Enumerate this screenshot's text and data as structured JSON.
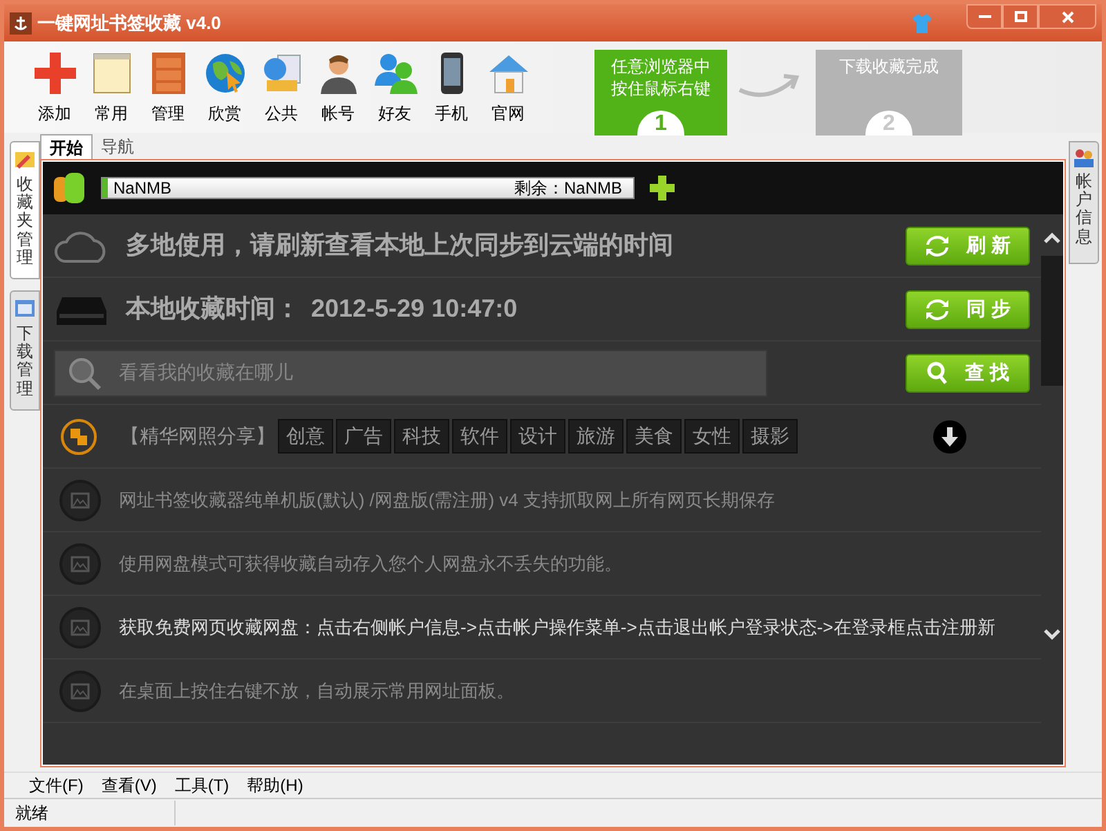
{
  "window": {
    "title": "一键网址书签收藏 v4.0"
  },
  "toolbar": [
    {
      "label": "添加",
      "kind": "plus"
    },
    {
      "label": "常用",
      "kind": "notepad"
    },
    {
      "label": "管理",
      "kind": "cabinet"
    },
    {
      "label": "欣赏",
      "kind": "globe"
    },
    {
      "label": "公共",
      "kind": "share"
    },
    {
      "label": "帐号",
      "kind": "user"
    },
    {
      "label": "好友",
      "kind": "users"
    },
    {
      "label": "手机",
      "kind": "phone"
    },
    {
      "label": "官网",
      "kind": "house"
    }
  ],
  "steps": [
    {
      "lines": [
        "任意浏览器中",
        "按住鼠标右键"
      ],
      "number": "1",
      "selected": true
    },
    {
      "lines": [
        "下载收藏完成"
      ],
      "number": "2",
      "selected": false
    }
  ],
  "left_tabs": [
    {
      "label": "收藏夹管理",
      "selected": true
    },
    {
      "label": "下载管理",
      "selected": false
    }
  ],
  "right_tabs": [
    {
      "label": "帐户信息",
      "selected": false
    }
  ],
  "tabs": [
    {
      "label": "开始",
      "selected": true
    },
    {
      "label": "导航",
      "selected": false
    }
  ],
  "storage": {
    "used": "NaNMB",
    "remaining_label": "剩余：",
    "remaining": "NaNMB",
    "level": 0.01
  },
  "cloud_row": {
    "text": "多地使用，请刷新查看本地上次同步到云端的时间",
    "button": "刷 新"
  },
  "local_row": {
    "label": "本地收藏时间：",
    "time": "2012-5-29 10:47:0",
    "button": "同 步"
  },
  "search": {
    "placeholder": "看看我的收藏在哪儿",
    "button": "查 找"
  },
  "share": {
    "label": "【精华网照分享】",
    "tags": [
      "创意",
      "广告",
      "科技",
      "软件",
      "设计",
      "旅游",
      "美食",
      "女性",
      "摄影"
    ]
  },
  "tips": [
    {
      "text": "网址书签收藏器纯单机版(默认) /网盘版(需注册) v4 支持抓取网上所有网页长期保存",
      "bright": false
    },
    {
      "text": "使用网盘模式可获得收藏自动存入您个人网盘永不丢失的功能。",
      "bright": false
    },
    {
      "text": "获取免费网页收藏网盘：点击右侧帐户信息->点击帐户操作菜单->点击退出帐户登录状态->在登录框点击注册新",
      "bright": true
    },
    {
      "text": "在桌面上按住右键不放，自动展示常用网址面板。",
      "bright": false
    }
  ],
  "menu": [
    "文件(F)",
    "查看(V)",
    "工具(T)",
    "帮助(H)"
  ],
  "status_bar": "就绪"
}
